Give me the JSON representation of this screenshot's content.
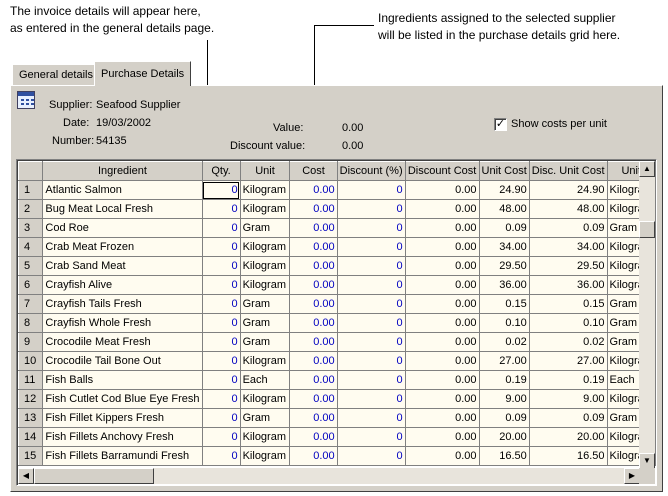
{
  "callouts": {
    "left": [
      "The invoice details will appear here,",
      "as entered in the general details page."
    ],
    "right": [
      "Ingredients assigned to the selected supplier",
      "will be listed in the purchase details grid here."
    ]
  },
  "tabs": [
    {
      "label": "General details",
      "active": false
    },
    {
      "label": "Purchase Details",
      "active": true
    }
  ],
  "invoice": {
    "supplier_label": "Supplier:",
    "supplier": "Seafood Supplier",
    "date_label": "Date:",
    "date": "19/03/2002",
    "number_label": "Number:",
    "number": "54135",
    "value_label": "Value:",
    "value": "0.00",
    "discount_label": "Discount value:",
    "discount": "0.00"
  },
  "show_costs": {
    "label": "Show costs per unit",
    "checked": true,
    "mark": "✓"
  },
  "grid": {
    "columns": [
      "Ingredient",
      "Qty.",
      "Unit",
      "Cost",
      "Discount (%)",
      "Discount Cost",
      "Unit Cost",
      "Disc. Unit Cost",
      "Unit"
    ],
    "rows": [
      [
        "1",
        "Atlantic Salmon",
        "0",
        "Kilogram",
        "0.00",
        "0",
        "0.00",
        "24.90",
        "24.90",
        "Kilogram"
      ],
      [
        "2",
        "Bug Meat Local Fresh",
        "0",
        "Kilogram",
        "0.00",
        "0",
        "0.00",
        "48.00",
        "48.00",
        "Kilogram"
      ],
      [
        "3",
        "Cod Roe",
        "0",
        "Gram",
        "0.00",
        "0",
        "0.00",
        "0.09",
        "0.09",
        "Gram"
      ],
      [
        "4",
        "Crab Meat Frozen",
        "0",
        "Kilogram",
        "0.00",
        "0",
        "0.00",
        "34.00",
        "34.00",
        "Kilogram"
      ],
      [
        "5",
        "Crab Sand Meat",
        "0",
        "Kilogram",
        "0.00",
        "0",
        "0.00",
        "29.50",
        "29.50",
        "Kilogram"
      ],
      [
        "6",
        "Crayfish Alive",
        "0",
        "Kilogram",
        "0.00",
        "0",
        "0.00",
        "36.00",
        "36.00",
        "Kilogram"
      ],
      [
        "7",
        "Crayfish Tails Fresh",
        "0",
        "Gram",
        "0.00",
        "0",
        "0.00",
        "0.15",
        "0.15",
        "Gram"
      ],
      [
        "8",
        "Crayfish Whole Fresh",
        "0",
        "Gram",
        "0.00",
        "0",
        "0.00",
        "0.10",
        "0.10",
        "Gram"
      ],
      [
        "9",
        "Crocodile Meat Fresh",
        "0",
        "Gram",
        "0.00",
        "0",
        "0.00",
        "0.02",
        "0.02",
        "Gram"
      ],
      [
        "10",
        "Crocodile Tail Bone Out",
        "0",
        "Kilogram",
        "0.00",
        "0",
        "0.00",
        "27.00",
        "27.00",
        "Kilogram"
      ],
      [
        "11",
        "Fish Balls",
        "0",
        "Each",
        "0.00",
        "0",
        "0.00",
        "0.19",
        "0.19",
        "Each"
      ],
      [
        "12",
        "Fish Cutlet Cod Blue Eye Fresh",
        "0",
        "Kilogram",
        "0.00",
        "0",
        "0.00",
        "9.00",
        "9.00",
        "Kilogram"
      ],
      [
        "13",
        "Fish Fillet Kippers Fresh",
        "0",
        "Gram",
        "0.00",
        "0",
        "0.00",
        "0.09",
        "0.09",
        "Gram"
      ],
      [
        "14",
        "Fish Fillets Anchovy Fresh",
        "0",
        "Kilogram",
        "0.00",
        "0",
        "0.00",
        "20.00",
        "20.00",
        "Kilogram"
      ],
      [
        "15",
        "Fish Fillets Barramundi Fresh",
        "0",
        "Kilogram",
        "0.00",
        "0",
        "0.00",
        "16.50",
        "16.50",
        "Kilogram"
      ]
    ]
  },
  "icons": {
    "scroll_up": "▲",
    "scroll_down": "▼",
    "scroll_left": "◀",
    "scroll_right": "▶"
  },
  "colors": {
    "panel": "#d4d0c8",
    "cell": "#fffcf0",
    "editable_text": "#0000c0"
  }
}
